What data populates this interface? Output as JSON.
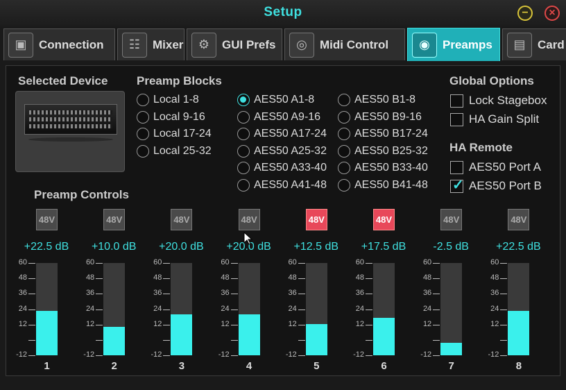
{
  "window": {
    "title": "Setup"
  },
  "tabs": [
    {
      "label": "Connection",
      "icon": "connection-icon",
      "glyph": "▣"
    },
    {
      "label": "Mixer",
      "icon": "mixer-icon",
      "glyph": "☷"
    },
    {
      "label": "GUI Prefs",
      "icon": "gear-icon",
      "glyph": "⚙"
    },
    {
      "label": "Midi Control",
      "icon": "midi-icon",
      "glyph": "◎"
    },
    {
      "label": "Preamps",
      "icon": "knob-icon",
      "glyph": "◉",
      "active": true
    },
    {
      "label": "Card",
      "icon": "card-icon",
      "glyph": "▤"
    }
  ],
  "selected_device": {
    "heading": "Selected Device"
  },
  "preamp_blocks": {
    "heading": "Preamp Blocks",
    "selected": "AES50 A1-8",
    "col1": [
      "Local 1-8",
      "Local 9-16",
      "Local 17-24",
      "Local 25-32"
    ],
    "col2": [
      "AES50 A1-8",
      "AES50 A9-16",
      "AES50 A17-24",
      "AES50 A25-32",
      "AES50 A33-40",
      "AES50 A41-48"
    ],
    "col3": [
      "AES50 B1-8",
      "AES50 B9-16",
      "AES50 B17-24",
      "AES50 B25-32",
      "AES50 B33-40",
      "AES50 B41-48"
    ]
  },
  "global_options": {
    "heading": "Global Options",
    "items": [
      {
        "label": "Lock Stagebox",
        "checked": false
      },
      {
        "label": "HA Gain Split",
        "checked": false
      }
    ]
  },
  "ha_remote": {
    "heading": "HA Remote",
    "items": [
      {
        "label": "AES50 Port A",
        "checked": false
      },
      {
        "label": "AES50 Port B",
        "checked": true
      }
    ]
  },
  "preamp_controls": {
    "heading": "Preamp Controls",
    "phantom_label": "48V",
    "scale_ticks": [
      "60",
      "48",
      "36",
      "24",
      "12",
      "",
      "-12"
    ],
    "scale_min": -12,
    "scale_max": 60,
    "channels": [
      {
        "number": "1",
        "gain_text": "+22.5 dB",
        "gain": 22.5,
        "phantom": false
      },
      {
        "number": "2",
        "gain_text": "+10.0 dB",
        "gain": 10.0,
        "phantom": false
      },
      {
        "number": "3",
        "gain_text": "+20.0 dB",
        "gain": 20.0,
        "phantom": false
      },
      {
        "number": "4",
        "gain_text": "+20.0 dB",
        "gain": 20.0,
        "phantom": false
      },
      {
        "number": "5",
        "gain_text": "+12.5 dB",
        "gain": 12.5,
        "phantom": true
      },
      {
        "number": "6",
        "gain_text": "+17.5 dB",
        "gain": 17.5,
        "phantom": true
      },
      {
        "number": "7",
        "gain_text": "-2.5 dB",
        "gain": -2.5,
        "phantom": false
      },
      {
        "number": "8",
        "gain_text": "+22.5 dB",
        "gain": 22.5,
        "phantom": false
      }
    ]
  },
  "colors": {
    "accent": "#3fe0e0",
    "phantom_on": "#e8485a",
    "meter_fill": "#3af0ec"
  }
}
